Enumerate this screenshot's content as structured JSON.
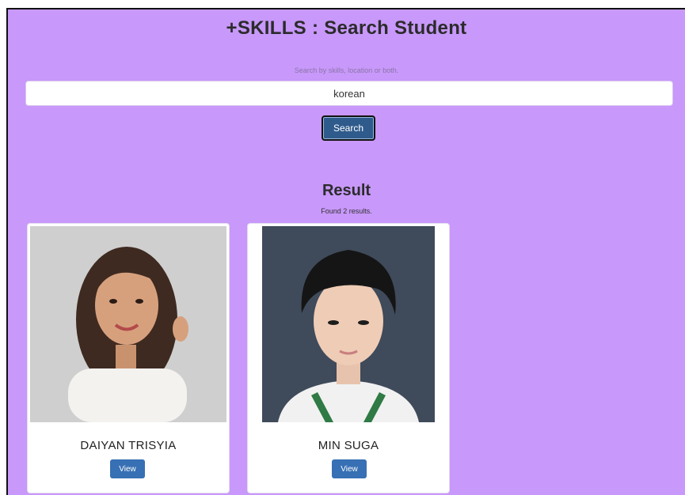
{
  "header": {
    "title": "+SKILLS : Search Student",
    "hint": "Search by skills, location or both."
  },
  "search": {
    "value": "korean",
    "button_label": "Search"
  },
  "results": {
    "title": "Result",
    "count_text": "Found 2 results.",
    "students": [
      {
        "name": "DAIYAN TRISYIA",
        "view_label": "View"
      },
      {
        "name": "MIN SUGA",
        "view_label": "View"
      }
    ]
  },
  "colors": {
    "page_background": "#c898fa",
    "search_button": "#2f5b8c",
    "view_button": "#3770b4"
  }
}
